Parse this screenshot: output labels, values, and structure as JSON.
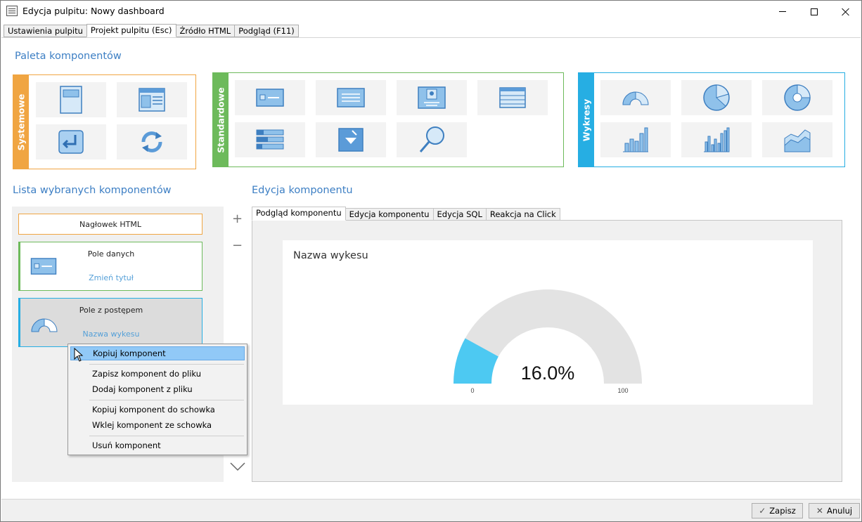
{
  "window": {
    "title": "Edycja pulpitu: Nowy dashboard"
  },
  "top_tabs": [
    {
      "label": "Ustawienia pulpitu"
    },
    {
      "label": "Projekt pulpitu (Esc)"
    },
    {
      "label": "Źródło HTML"
    },
    {
      "label": "Podgląd (F11)"
    }
  ],
  "palette": {
    "title": "Paleta komponentów",
    "groups": [
      {
        "label": "Systemowe",
        "color": "#f0a542"
      },
      {
        "label": "Standardowe",
        "color": "#6dba5b"
      },
      {
        "label": "Wykresy",
        "color": "#26aee3"
      }
    ]
  },
  "list": {
    "title": "Lista wybranych komponentów",
    "items": [
      {
        "title": "Nagłowek HTML",
        "subtitle": ""
      },
      {
        "title": "Pole danych",
        "subtitle": "Zmień tytuł"
      },
      {
        "title": "Pole z postępem",
        "subtitle": "Nazwa wykesu"
      }
    ]
  },
  "context_menu": {
    "items": [
      "Kopiuj komponent",
      "Zapisz komponent do pliku",
      "Dodaj komponent z pliku",
      "Kopiuj komponent do schowka",
      "Wklej komponent ze schowka",
      "Usuń komponent"
    ]
  },
  "edit": {
    "title": "Edycja komponentu",
    "tabs": [
      {
        "label": "Podgląd komponentu"
      },
      {
        "label": "Edycja komponentu"
      },
      {
        "label": "Edycja SQL"
      },
      {
        "label": "Reakcja na Click"
      }
    ]
  },
  "chart_data": {
    "type": "gauge",
    "title": "Nazwa wykesu",
    "value": 16.0,
    "value_label": "16.0%",
    "min": 0,
    "max": 100,
    "min_label": "0",
    "max_label": "100",
    "fill_color": "#4dc9f2",
    "track_color": "#e3e3e3"
  },
  "buttons": {
    "save": "Zapisz",
    "cancel": "Anuluj"
  }
}
